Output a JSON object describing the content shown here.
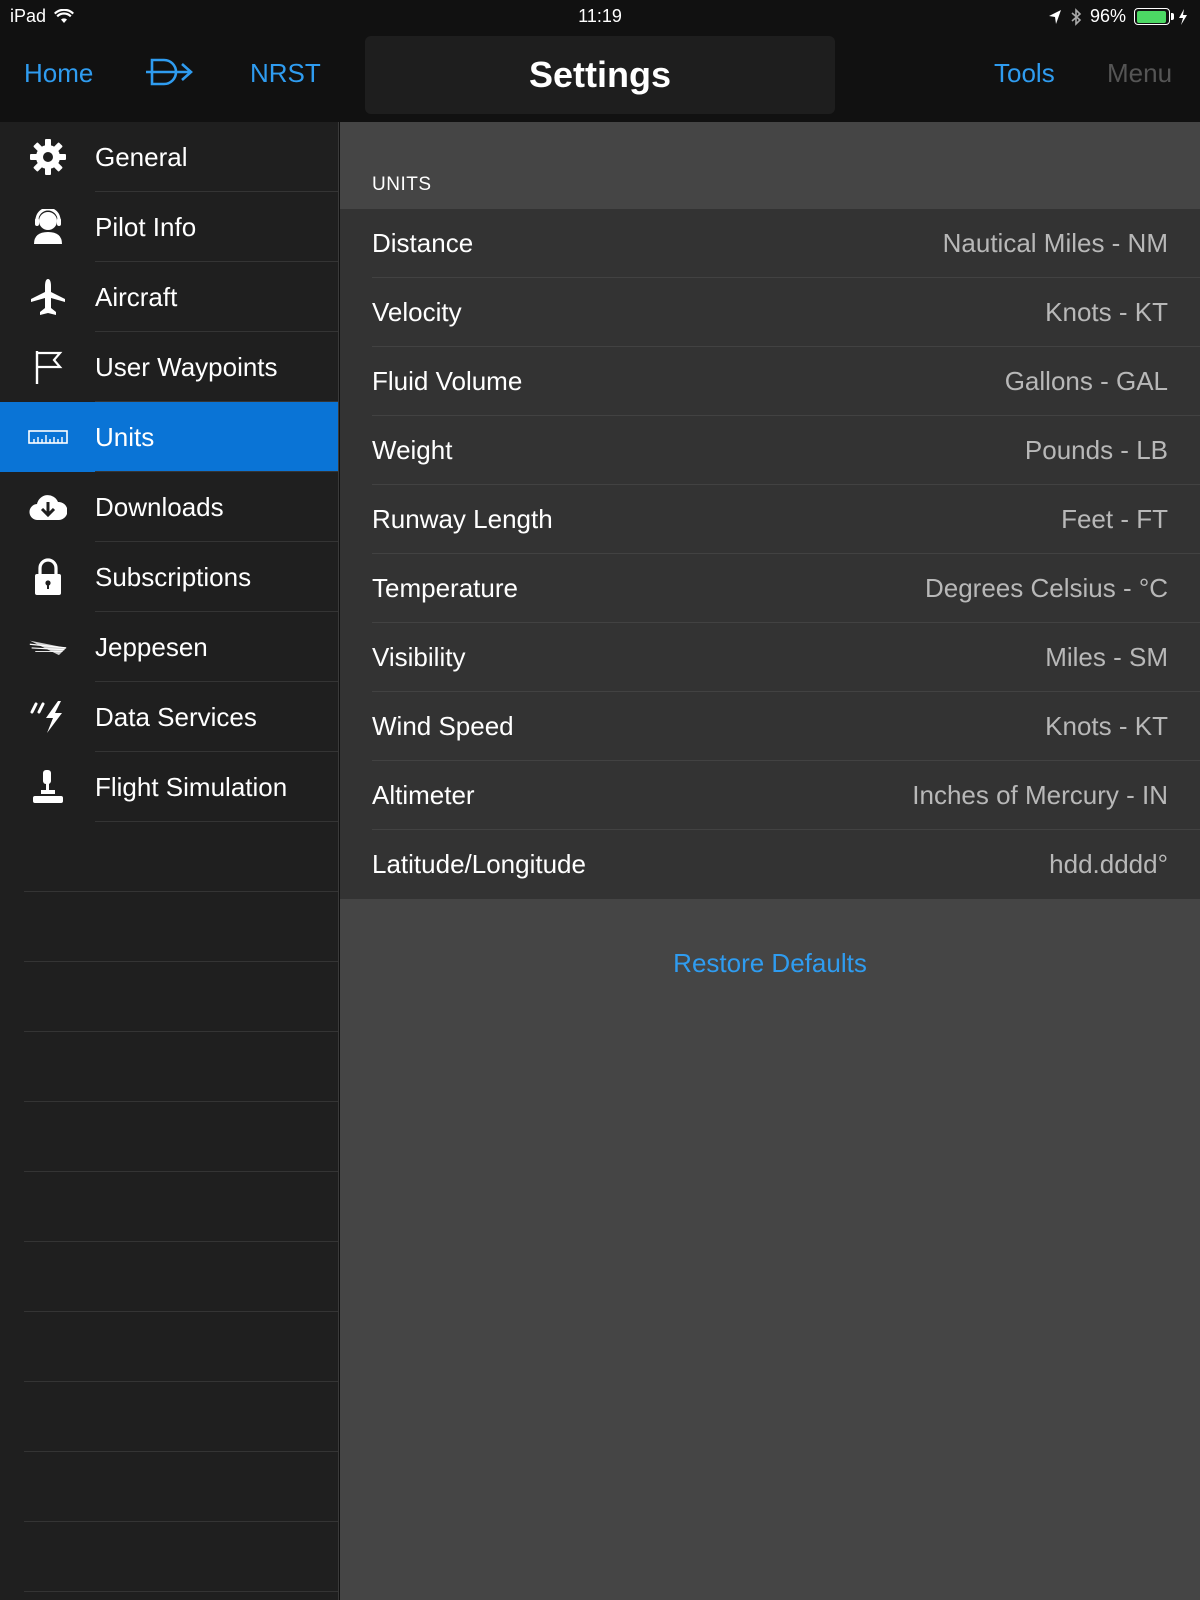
{
  "status": {
    "device": "iPad",
    "time": "11:19",
    "battery": "96%",
    "battery_level": 0.96,
    "battery_color": "#4cd964"
  },
  "nav": {
    "home": "Home",
    "nrst": "NRST",
    "title": "Settings",
    "tools": "Tools",
    "menu": "Menu"
  },
  "sidebar": {
    "items": [
      {
        "label": "General",
        "icon": "gear-icon"
      },
      {
        "label": "Pilot Info",
        "icon": "pilot-icon"
      },
      {
        "label": "Aircraft",
        "icon": "airplane-icon"
      },
      {
        "label": "User Waypoints",
        "icon": "flag-icon"
      },
      {
        "label": "Units",
        "icon": "ruler-icon"
      },
      {
        "label": "Downloads",
        "icon": "cloud-download-icon"
      },
      {
        "label": "Subscriptions",
        "icon": "lock-icon"
      },
      {
        "label": "Jeppesen",
        "icon": "jeppesen-icon"
      },
      {
        "label": "Data Services",
        "icon": "lightning-icon"
      },
      {
        "label": "Flight Simulation",
        "icon": "joystick-icon"
      }
    ],
    "active_index": 4
  },
  "units": {
    "header": "UNITS",
    "rows": [
      {
        "label": "Distance",
        "value": "Nautical Miles - NM"
      },
      {
        "label": "Velocity",
        "value": "Knots - KT"
      },
      {
        "label": "Fluid Volume",
        "value": "Gallons - GAL"
      },
      {
        "label": "Weight",
        "value": "Pounds - LB"
      },
      {
        "label": "Runway Length",
        "value": "Feet - FT"
      },
      {
        "label": "Temperature",
        "value": "Degrees Celsius - °C"
      },
      {
        "label": "Visibility",
        "value": "Miles - SM"
      },
      {
        "label": "Wind Speed",
        "value": "Knots - KT"
      },
      {
        "label": "Altimeter",
        "value": "Inches of Mercury - IN"
      },
      {
        "label": "Latitude/Longitude",
        "value": "hdd.dddd°"
      }
    ],
    "restore_label": "Restore Defaults"
  },
  "colors": {
    "accent": "#2f9cf0",
    "active_bg": "#0a74d6"
  }
}
